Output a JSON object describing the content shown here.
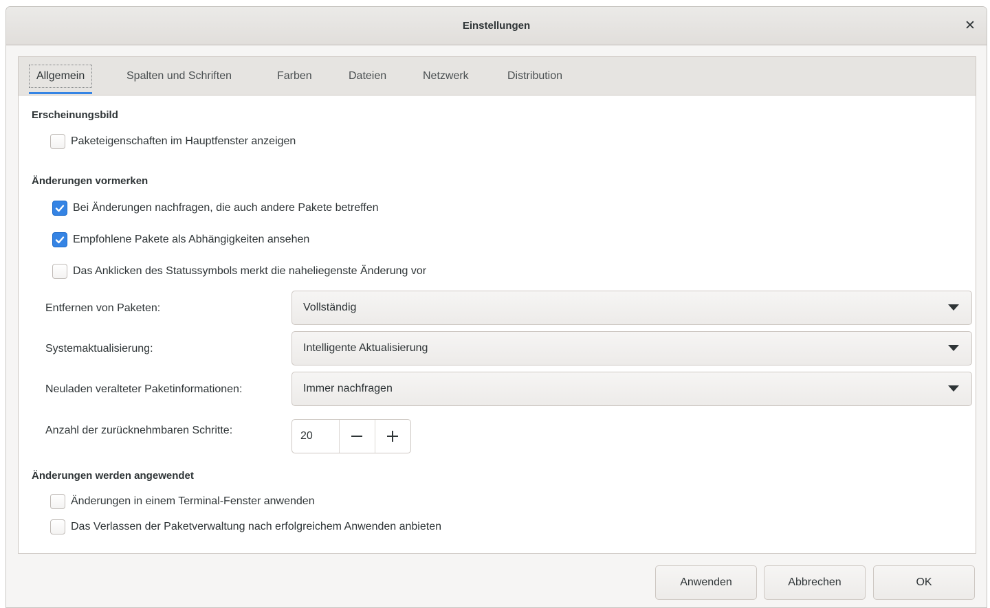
{
  "window": {
    "title": "Einstellungen",
    "close_icon": "close-icon"
  },
  "tabs": [
    {
      "label": "Allgemein",
      "active": true
    },
    {
      "label": "Spalten und Schriften",
      "active": false
    },
    {
      "label": "Farben",
      "active": false
    },
    {
      "label": "Dateien",
      "active": false
    },
    {
      "label": "Netzwerk",
      "active": false
    },
    {
      "label": "Distribution",
      "active": false
    }
  ],
  "sections": {
    "appearance": {
      "title": "Erscheinungsbild",
      "options": [
        {
          "label": "Paketeigenschaften im Hauptfenster anzeigen",
          "checked": false
        }
      ]
    },
    "marking": {
      "title": "Änderungen vormerken",
      "options": [
        {
          "label": "Bei Änderungen nachfragen, die auch andere Pakete betreffen",
          "checked": true
        },
        {
          "label": "Empfohlene Pakete als Abhängigkeiten ansehen",
          "checked": true
        },
        {
          "label": "Das Anklicken des Statussymbols merkt die naheliegenste Änderung vor",
          "checked": false
        }
      ],
      "fields": {
        "removal": {
          "label": "Entfernen von Paketen:",
          "value": "Vollständig"
        },
        "upgrade": {
          "label": "Systemaktualisierung:",
          "value": "Intelligente Aktualisierung"
        },
        "reload": {
          "label": "Neuladen veralteter Paketinformationen:",
          "value": "Immer nachfragen"
        },
        "undo_steps": {
          "label": "Anzahl der zurücknehmbaren Schritte:",
          "value": "20"
        }
      }
    },
    "applying": {
      "title": "Änderungen werden angewendet",
      "options": [
        {
          "label": "Änderungen in einem Terminal-Fenster anwenden",
          "checked": false
        },
        {
          "label": "Das Verlassen der Paketverwaltung nach erfolgreichem Anwenden anbieten",
          "checked": false
        }
      ]
    }
  },
  "footer": {
    "apply_label": "Anwenden",
    "cancel_label": "Abbrechen",
    "ok_label": "OK"
  },
  "colors": {
    "accent": "#3584e4",
    "window_bg": "#f6f5f4",
    "text": "#2e3436"
  }
}
